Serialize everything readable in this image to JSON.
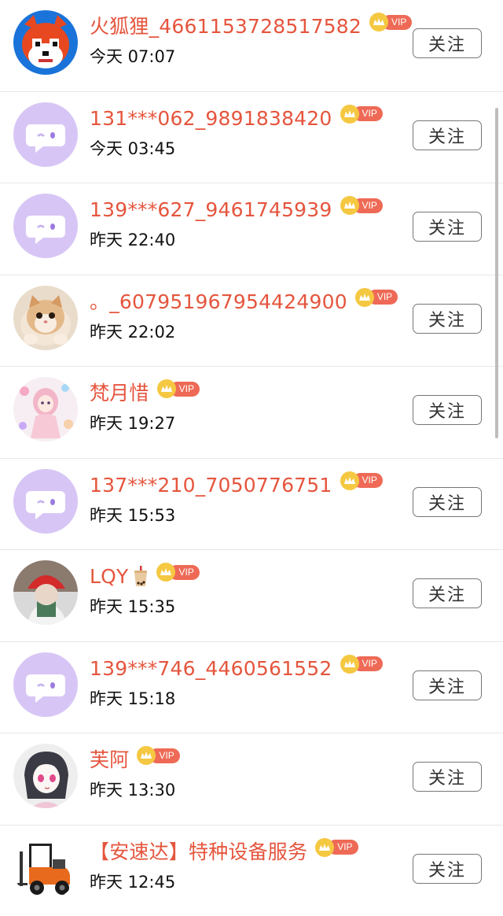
{
  "users": [
    {
      "name": "火狐狸_4661153728517582",
      "time": "今天 07:07",
      "avatar": "fox-avatar",
      "emoji": ""
    },
    {
      "name": "131***062_9891838420",
      "time": "今天 03:45",
      "avatar": "default-chat-avatar",
      "emoji": ""
    },
    {
      "name": "139***627_9461745939",
      "time": "昨天 22:40",
      "avatar": "default-chat-avatar",
      "emoji": ""
    },
    {
      "name": "。_607951967954424900",
      "time": "昨天 22:02",
      "avatar": "cat-photo-avatar",
      "emoji": ""
    },
    {
      "name": "梵月惜",
      "time": "昨天 19:27",
      "avatar": "anime-girl-avatar",
      "emoji": ""
    },
    {
      "name": "137***210_7050776751",
      "time": "昨天 15:53",
      "avatar": "default-chat-avatar",
      "emoji": ""
    },
    {
      "name": "LQY",
      "time": "昨天 15:35",
      "avatar": "person-red-cap-avatar",
      "emoji": "bubble-tea"
    },
    {
      "name": "139***746_4460561552",
      "time": "昨天 15:18",
      "avatar": "default-chat-avatar",
      "emoji": ""
    },
    {
      "name": "芙阿",
      "time": "昨天 13:30",
      "avatar": "anime-sketch-avatar",
      "emoji": ""
    },
    {
      "name": "【安速达】特种设备服务",
      "time": "昨天 12:45",
      "avatar": "forklift-avatar",
      "emoji": ""
    }
  ],
  "vip_label": "VIP",
  "follow_label": "关注",
  "colors": {
    "name": "#e5553d",
    "vip_pill": "#ee6a56",
    "crown": "#f5c842",
    "default_avatar_bg": "#d7c6f5"
  }
}
